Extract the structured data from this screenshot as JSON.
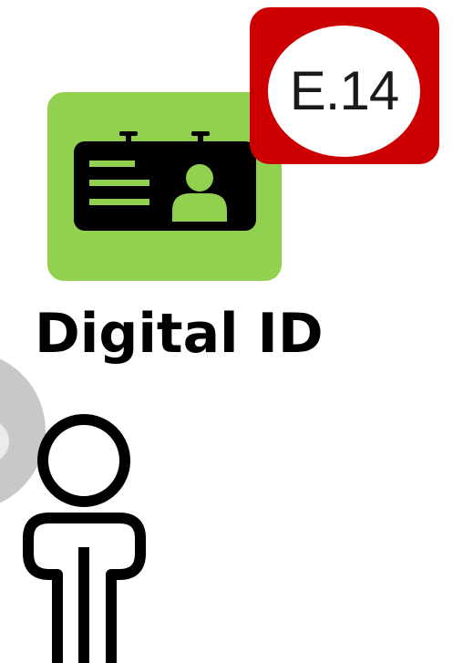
{
  "badge": {
    "label": "E.14",
    "color": "#cc0000"
  },
  "app": {
    "icon": "id-card-icon",
    "tile_color": "#92d050",
    "title": "Digital ID"
  },
  "person": {
    "icon": "person-icon"
  }
}
